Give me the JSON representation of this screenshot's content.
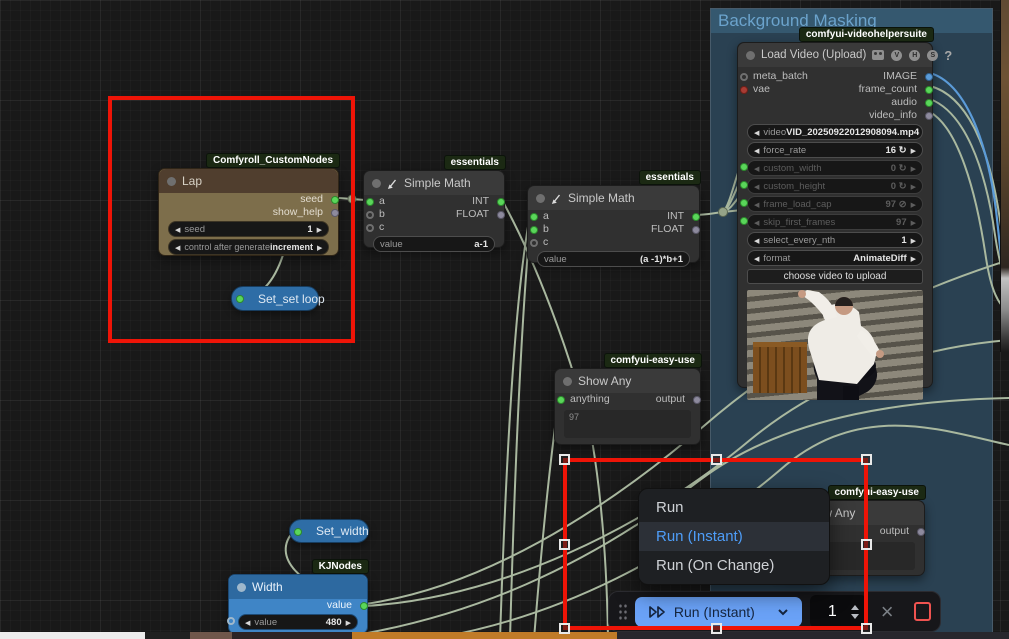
{
  "group_title": "Background Masking",
  "nodes": {
    "load_video": {
      "badge": "comfyui-videohelpersuite",
      "title": "Load Video (Upload)",
      "vhs": [
        "V",
        "H",
        "S"
      ],
      "help": "?",
      "inputs": [
        "meta_batch",
        "vae"
      ],
      "outputs": [
        "IMAGE",
        "frame_count",
        "audio",
        "video_info"
      ],
      "widgets": [
        {
          "name": "video",
          "value": "VID_20250922012908094.mp4"
        },
        {
          "name": "force_rate",
          "value": "16 ↻"
        },
        {
          "name": "custom_width",
          "value": "0 ↻"
        },
        {
          "name": "custom_height",
          "value": "0 ↻"
        },
        {
          "name": "frame_load_cap",
          "value": "97 ⊘"
        },
        {
          "name": "skip_first_frames",
          "value": "97"
        },
        {
          "name": "select_every_nth",
          "value": "1"
        },
        {
          "name": "format",
          "value": "AnimateDiff"
        }
      ],
      "upload_button": "choose video to upload"
    },
    "lap": {
      "badge": "Comfyroll_CustomNodes",
      "title": "Lap",
      "outputs": [
        "seed",
        "show_help"
      ],
      "widgets": [
        {
          "name": "seed",
          "value": "1"
        },
        {
          "name": "control after generate",
          "value": "increment"
        }
      ]
    },
    "math1": {
      "badge": "essentials",
      "title": "Simple Math",
      "inputs": [
        "a",
        "b",
        "c"
      ],
      "outputs": [
        "INT",
        "FLOAT"
      ],
      "widgets": [
        {
          "name": "value",
          "value": "a-1"
        }
      ]
    },
    "math2": {
      "badge": "essentials",
      "title": "Simple Math",
      "inputs": [
        "a",
        "b",
        "c"
      ],
      "outputs": [
        "INT",
        "FLOAT"
      ],
      "widgets": [
        {
          "name": "value",
          "value": "(a -1)*b+1"
        }
      ]
    },
    "show_any1": {
      "badge": "comfyui-easy-use",
      "title": "Show Any",
      "input": "anything",
      "output": "output",
      "content": "97"
    },
    "show_any2": {
      "badge": "comfyui-easy-use",
      "title": "Show Any",
      "output": "output"
    },
    "set_loop": {
      "title": "Set_set loop"
    },
    "set_width": {
      "title": "Set_width"
    },
    "width": {
      "badge": "KJNodes",
      "title": "Width",
      "output": "value",
      "widgets": [
        {
          "name": "value",
          "value": "480"
        }
      ]
    }
  },
  "context_menu": {
    "items": [
      "Run",
      "Run (Instant)",
      "Run (On Change)"
    ]
  },
  "toolbar": {
    "run_label": "Run (Instant)",
    "queue_count": "1"
  }
}
